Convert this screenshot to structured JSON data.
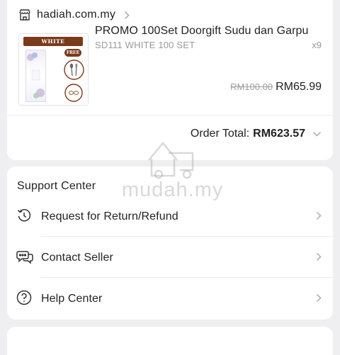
{
  "shop": {
    "name": "hadiah.com.my",
    "icon": "shop-icon"
  },
  "product": {
    "thumb_banner": "WHITE",
    "thumb_badge": "FREE",
    "name": "PROMO 100Set Doorgift Sudu dan Garpu",
    "variant": "SD111 WHITE 100 SET",
    "quantity": "x9",
    "original_price": "RM100.00",
    "price": "RM65.99"
  },
  "order_total": {
    "label": "Order Total:",
    "value": "RM623.57"
  },
  "support": {
    "title": "Support Center",
    "items": [
      {
        "label": "Request for Return/Refund",
        "icon": "return-icon"
      },
      {
        "label": "Contact Seller",
        "icon": "chat-icon"
      },
      {
        "label": "Help Center",
        "icon": "help-icon"
      }
    ]
  },
  "watermark": "mudah.my",
  "colors": {
    "background": "#efeff1",
    "card": "#ffffff",
    "text": "#222222",
    "muted": "#9a9a9a",
    "brand_brown": "#7a3a1c"
  }
}
